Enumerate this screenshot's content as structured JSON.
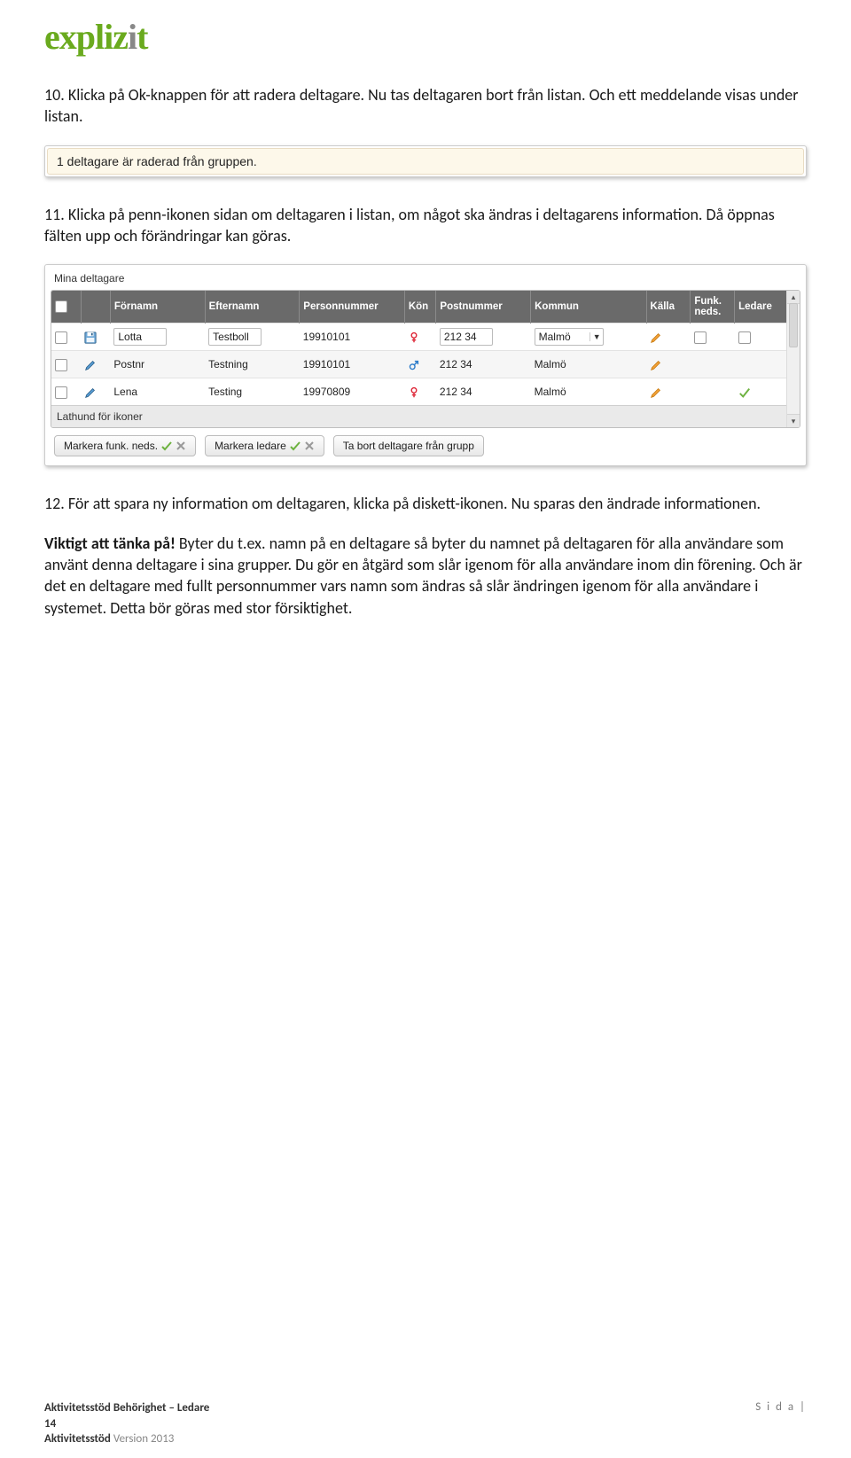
{
  "logo": {
    "text_plain": "explizit"
  },
  "para1": "10. Klicka på Ok-knappen för att radera deltagare. Nu tas deltagaren bort från listan. Och ett meddelande visas under listan.",
  "msg": "1 deltagare är raderad från gruppen.",
  "para2": "11. Klicka på penn-ikonen sidan om deltagaren i listan, om något ska ändras i deltagarens information. Då öppnas fälten upp och förändringar kan göras.",
  "grid": {
    "title": "Mina deltagare",
    "headers": {
      "fornamn": "Förnamn",
      "efternamn": "Efternamn",
      "personnummer": "Personnummer",
      "kon": "Kön",
      "postnummer": "Postnummer",
      "kommun": "Kommun",
      "kalla": "Källa",
      "funk": "Funk. neds.",
      "ledare": "Ledare"
    },
    "rows": [
      {
        "fornamn": "Lotta",
        "efternamn": "Testboll",
        "pnr": "19910101",
        "kon": "F",
        "post": "212 34",
        "kommun": "Malmö",
        "editable": true
      },
      {
        "fornamn": "Postnr",
        "efternamn": "Testning",
        "pnr": "19910101",
        "kon": "M",
        "post": "212 34",
        "kommun": "Malmö",
        "editable": false
      },
      {
        "fornamn": "Lena",
        "efternamn": "Testing",
        "pnr": "19970809",
        "kon": "F",
        "post": "212 34",
        "kommun": "Malmö",
        "editable": false,
        "ledare_check": true
      }
    ],
    "footer_label": "Lathund för ikoner",
    "buttons": {
      "b1": "Markera funk. neds.",
      "b2": "Markera ledare",
      "b3": "Ta bort deltagare från grupp"
    }
  },
  "para3": "12. För att spara ny information om deltagaren, klicka på diskett-ikonen. Nu sparas den ändrade informationen.",
  "para4_strong": "Viktigt att tänka på!",
  "para4_rest": " Byter du t.ex. namn på en deltagare så byter du namnet på deltagaren för alla användare som använt denna deltagare i sina grupper. Du gör en åtgärd som slår igenom för alla användare inom din förening. Och är det en deltagare med fullt personnummer vars namn som ändras så slår ändringen igenom för alla användare i systemet. Detta bör göras med stor försiktighet.",
  "footer": {
    "line1a": "Aktivitetsstöd Behörighet – Ledare",
    "page_no": "14",
    "line2a": "Aktivitetsstöd ",
    "line2b": "Version 2013",
    "right": "S i d a  |"
  }
}
